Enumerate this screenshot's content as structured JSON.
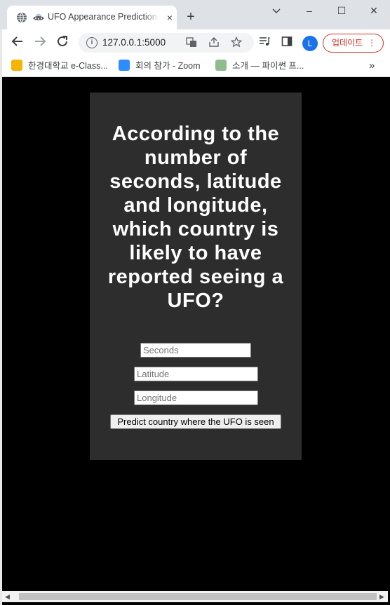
{
  "tab": {
    "title": "UFO Appearance Prediction",
    "close": "×",
    "new_tab": "+"
  },
  "window_controls": {
    "minimize": "–",
    "maximize": "☐",
    "close": "✕"
  },
  "toolbar": {
    "url": "127.0.0.1:5000",
    "avatar_letter": "L",
    "update_label": "업데이트"
  },
  "bookmarks": [
    {
      "label": "한경대학교 e-Class...",
      "icon_color": "#f4b400"
    },
    {
      "label": "회의 참가 - Zoom",
      "icon_color": "#2d8cff"
    },
    {
      "label": "소개 — 파이썬 프...",
      "icon_color": "#8fbc8f"
    }
  ],
  "bookmarks_overflow": "»",
  "page": {
    "heading": "According to the number of seconds, latitude and longitude, which country is likely to have reported seeing a UFO?",
    "seconds_placeholder": "Seconds",
    "latitude_placeholder": "Latitude",
    "longitude_placeholder": "Longitude",
    "submit_label": "Predict country where the UFO is seen"
  },
  "colors": {
    "page_background": "#000000",
    "card_background": "#2d2d2d",
    "heading_text": "#ffffff",
    "update_accent": "#d93025"
  }
}
